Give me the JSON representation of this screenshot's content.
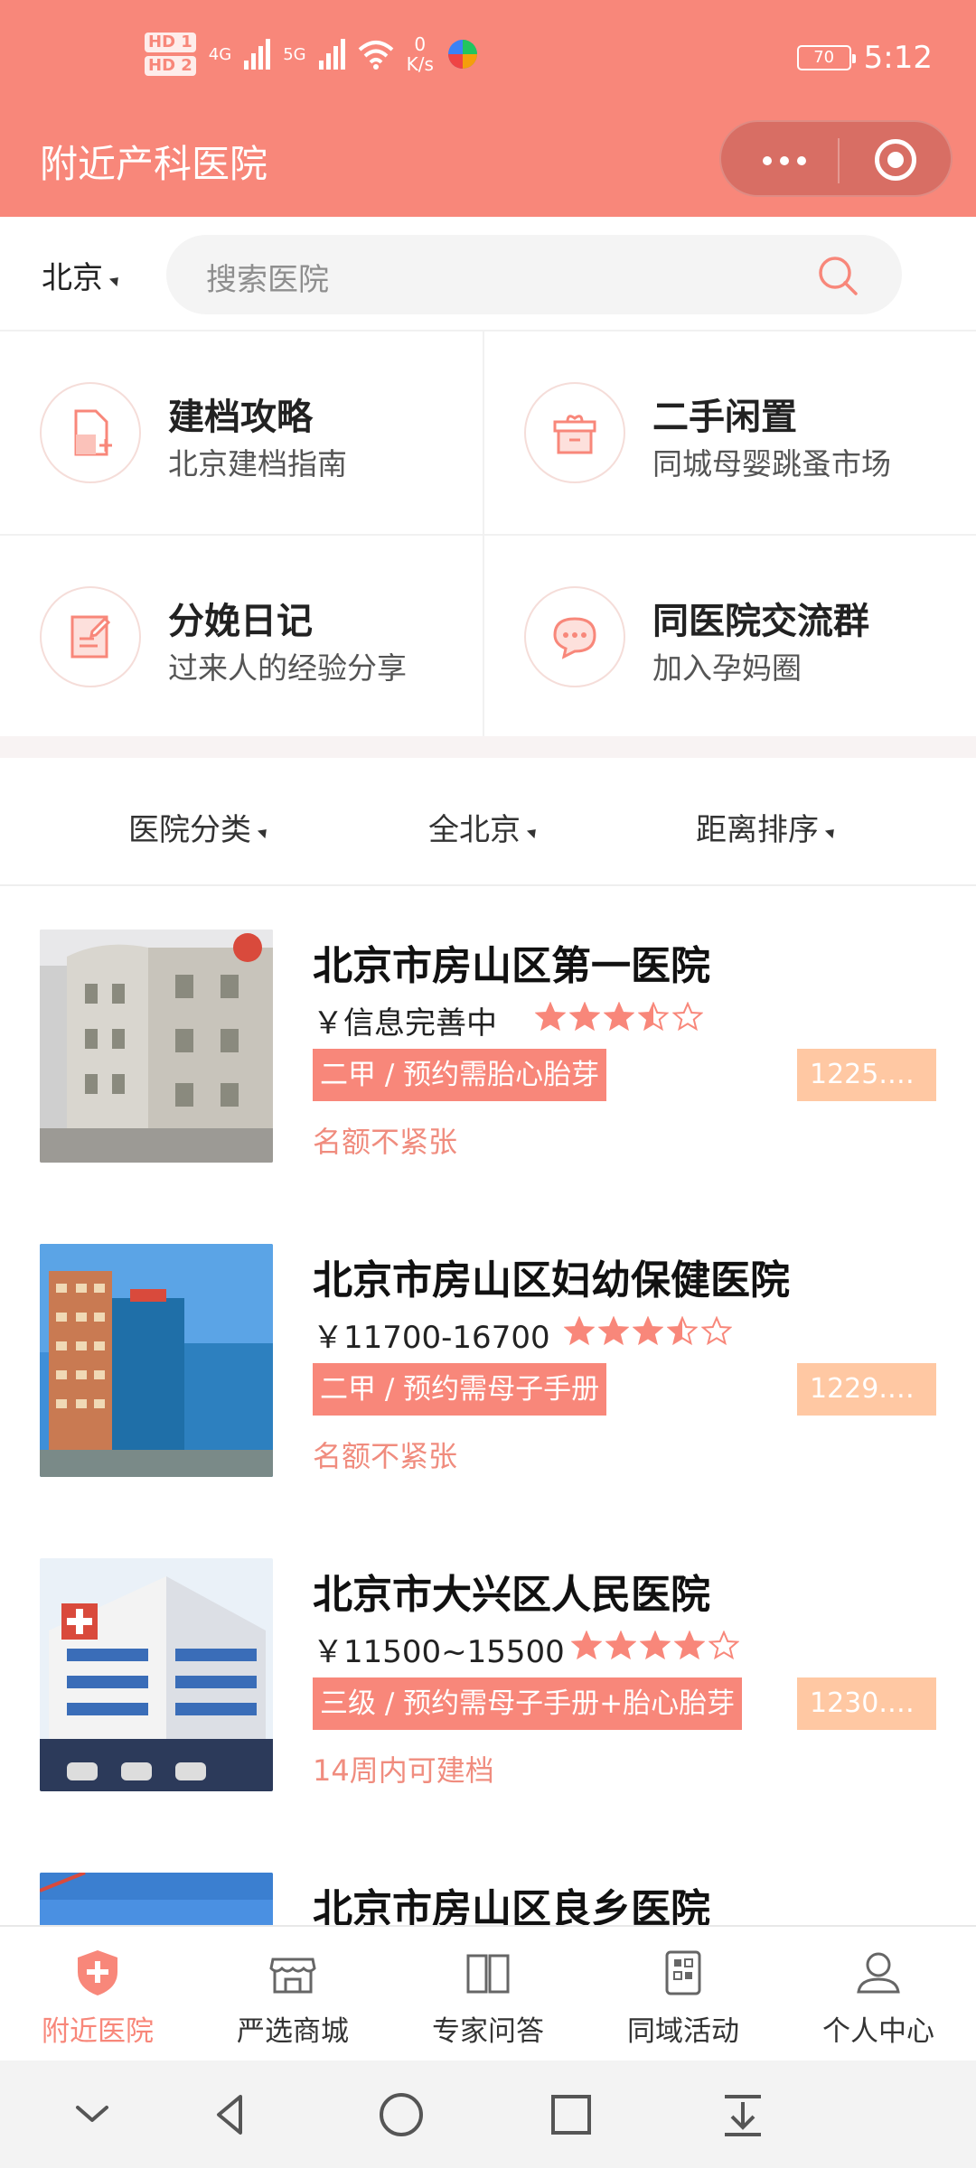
{
  "status_bar": {
    "hd1": "HD 1",
    "hd2": "HD 2",
    "sig1": "4G",
    "sig2": "5G",
    "net_speed_value": "0",
    "net_speed_unit": "K/s",
    "battery": "70",
    "time": "5:12"
  },
  "header": {
    "title": "附近产科医院"
  },
  "search": {
    "city": "北京",
    "placeholder": "搜索医院"
  },
  "features": [
    {
      "title": "建档攻略",
      "subtitle": "北京建档指南",
      "icon": "file-add-icon"
    },
    {
      "title": "二手闲置",
      "subtitle": "同城母婴跳蚤市场",
      "icon": "gift-box-icon"
    },
    {
      "title": "分娩日记",
      "subtitle": "过来人的经验分享",
      "icon": "notebook-edit-icon"
    },
    {
      "title": "同医院交流群",
      "subtitle": "加入孕妈圈",
      "icon": "chat-bubbles-icon"
    }
  ],
  "filters": [
    "医院分类",
    "全北京",
    "距离排序"
  ],
  "hospitals": [
    {
      "name": "北京市房山区第一医院",
      "price": "￥信息完善中",
      "rating": 3.5,
      "tag": "二甲 / 预约需胎心胎芽",
      "badge": "1225.…",
      "note": "名额不紧张"
    },
    {
      "name": "北京市房山区妇幼保健医院",
      "price": "￥11700-16700",
      "rating": 3.5,
      "tag": "二甲 / 预约需母子手册",
      "badge": "1229.…",
      "note": "名额不紧张"
    },
    {
      "name": "北京市大兴区人民医院",
      "price": "￥11500~15500",
      "rating": 4,
      "tag": "三级 / 预约需母子手册+胎心胎芽",
      "badge": "1230.…",
      "note": "14周内可建档"
    },
    {
      "name": "北京市房山区良乡医院",
      "price": "",
      "rating": 0,
      "tag": "",
      "badge": "",
      "note": ""
    }
  ],
  "tabs": [
    {
      "label": "附近医院",
      "icon": "hospital-shield-icon",
      "active": true
    },
    {
      "label": "严选商城",
      "icon": "store-icon",
      "active": false
    },
    {
      "label": "专家问答",
      "icon": "open-book-icon",
      "active": false
    },
    {
      "label": "同域活动",
      "icon": "building-icon",
      "active": false
    },
    {
      "label": "个人中心",
      "icon": "user-icon",
      "active": false
    }
  ],
  "colors": {
    "accent": "#f8877a",
    "badge": "#ffc8a3",
    "star": "#f8877a"
  }
}
